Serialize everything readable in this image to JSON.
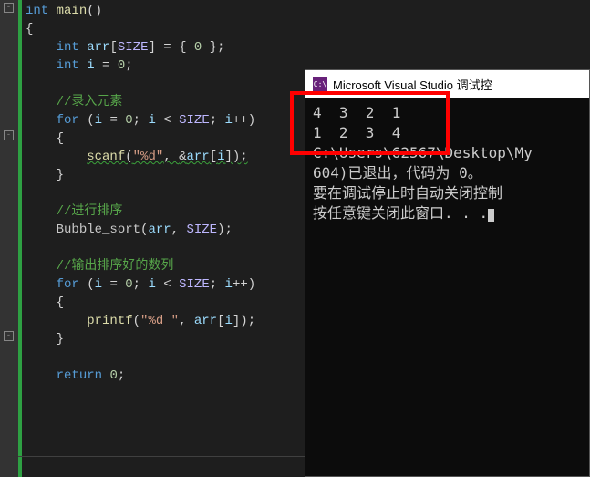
{
  "editor": {
    "fold_icons": [
      "-",
      "-",
      "-"
    ],
    "lines": {
      "l1_kw1": "int",
      "l1_func": "main",
      "l1_paren": "()",
      "l2": "{",
      "l3_type": "int",
      "l3_ident": "arr",
      "l3_macro": "SIZE",
      "l3_rest1": "[",
      "l3_rest2": "] = { ",
      "l3_num": "0",
      "l3_rest3": " };",
      "l4_type": "int",
      "l4_ident": "i",
      "l4_rest": " = ",
      "l4_num": "0",
      "l4_semi": ";",
      "l6_comment": "//录入元素",
      "l7_for": "for",
      "l7_open": " (",
      "l7_i1": "i",
      "l7_eq": " = ",
      "l7_z": "0",
      "l7_sc1": "; ",
      "l7_i2": "i",
      "l7_lt": " < ",
      "l7_size": "SIZE",
      "l7_sc2": "; ",
      "l7_i3": "i",
      "l7_pp": "++)",
      "l8": "{",
      "l9_scanf": "scanf",
      "l9_open": "(",
      "l9_fmt": "\"%d\"",
      "l9_comma": ", ",
      "l9_amp": "&",
      "l9_arr": "arr",
      "l9_br1": "[",
      "l9_i": "i",
      "l9_br2": "]);",
      "l10": "}",
      "l12_comment": "//进行排序",
      "l13_call": "Bubble_sort",
      "l13_open": "(",
      "l13_arr": "arr",
      "l13_comma": ", ",
      "l13_size": "SIZE",
      "l13_close": ");",
      "l15_comment": "//输出排序好的数列",
      "l16_for": "for",
      "l16_open": " (",
      "l16_i1": "i",
      "l16_eq": " = ",
      "l16_z": "0",
      "l16_sc1": "; ",
      "l16_i2": "i",
      "l16_lt": " < ",
      "l16_size": "SIZE",
      "l16_sc2": "; ",
      "l16_i3": "i",
      "l16_pp": "++)",
      "l17": "{",
      "l18_printf": "printf",
      "l18_open": "(",
      "l18_fmt": "\"%d \"",
      "l18_comma": ", ",
      "l18_arr": "arr",
      "l18_br1": "[",
      "l18_i": "i",
      "l18_br2": "]);",
      "l19": "}",
      "l21_ret": "return",
      "l21_sp": " ",
      "l21_num": "0",
      "l21_semi": ";"
    }
  },
  "console": {
    "icon_text": "C:\\",
    "title": "Microsoft Visual Studio 调试控",
    "line1": "4  3  2  1",
    "line2": "1  2  3  4",
    "line3": "C:\\Users\\62567\\Desktop\\My",
    "line4": "604)已退出，代码为 0。",
    "line5": "要在调试停止时自动关闭控制",
    "line6": "按任意键关闭此窗口. . ."
  }
}
